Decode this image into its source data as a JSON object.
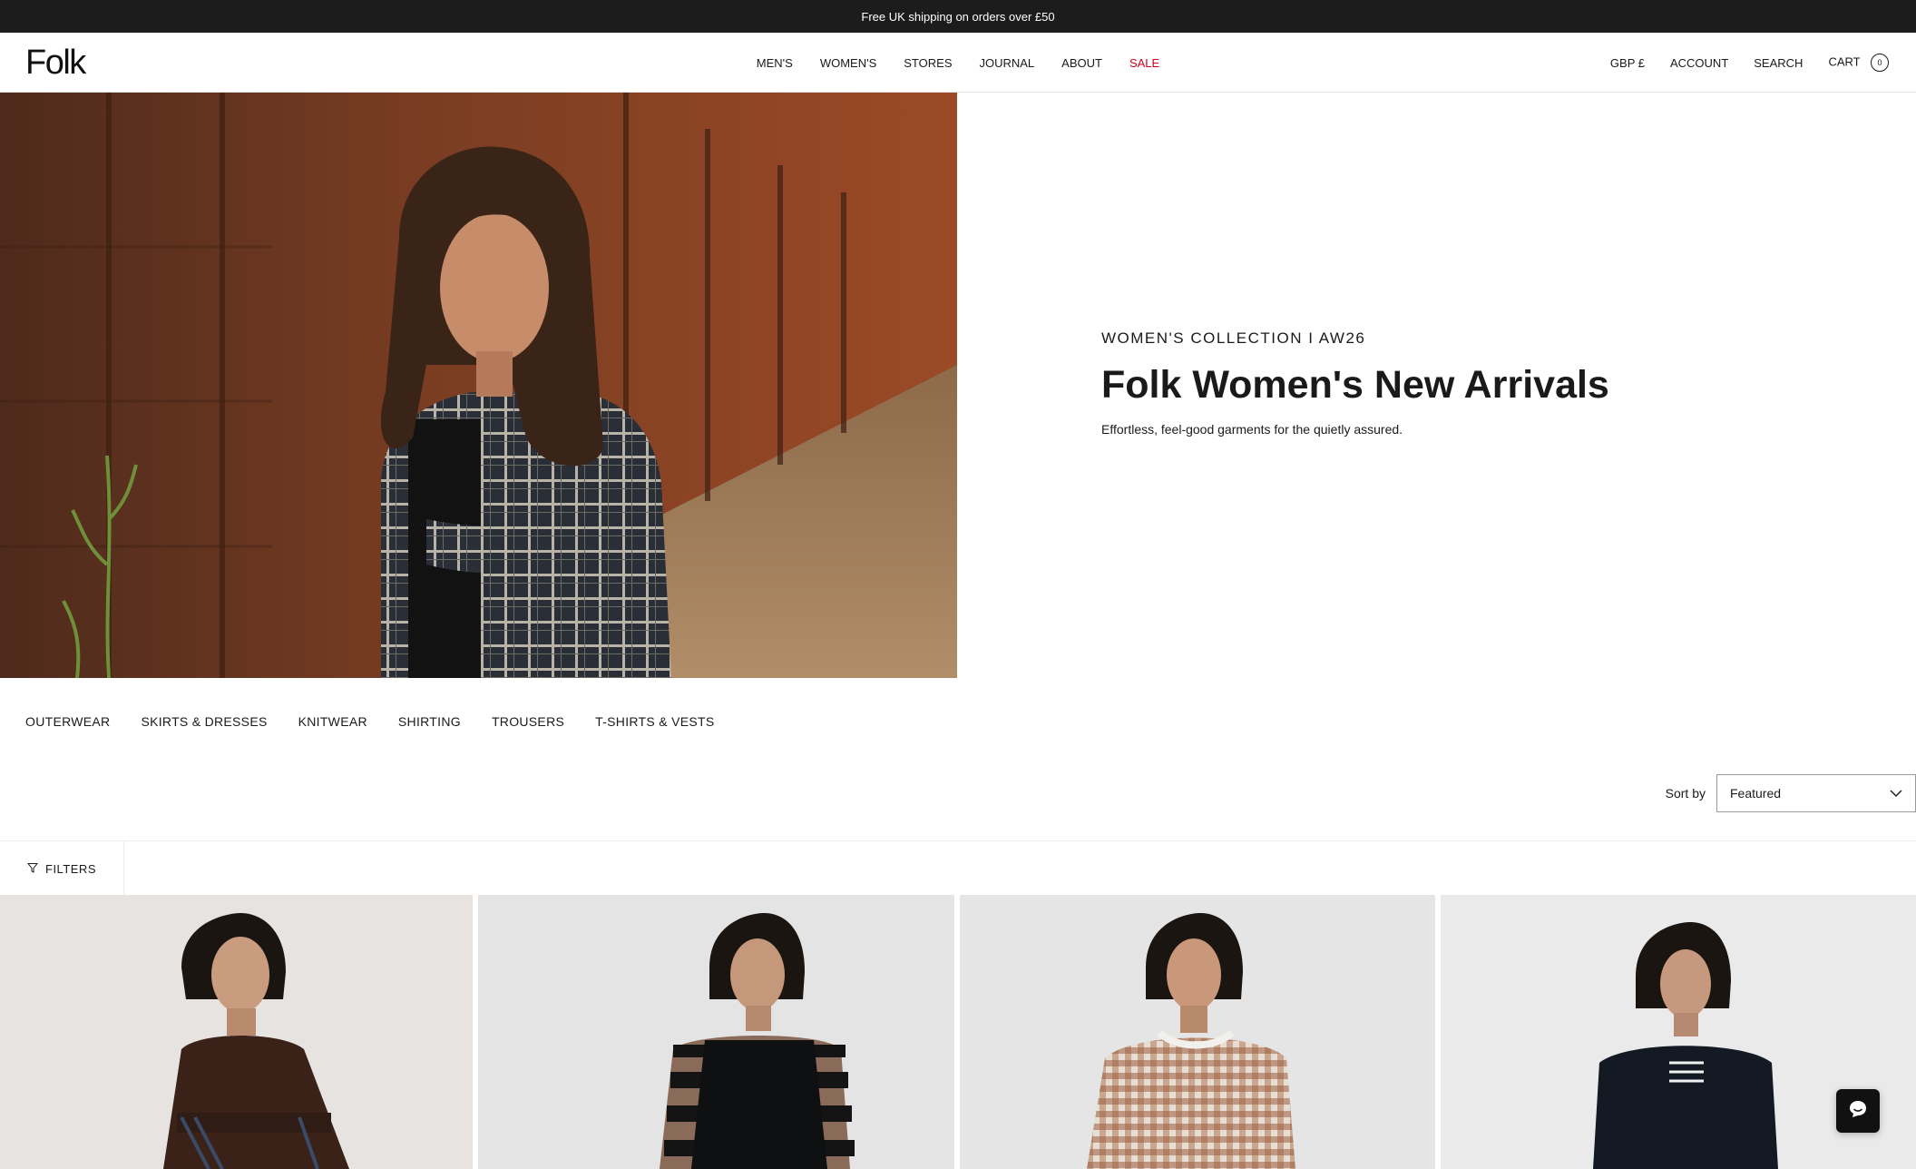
{
  "announcement": {
    "text": "Free UK shipping on orders over £50"
  },
  "header": {
    "logo": "Folk",
    "nav": [
      {
        "label": "MEN'S",
        "sale": false
      },
      {
        "label": "WOMEN'S",
        "sale": false
      },
      {
        "label": "STORES",
        "sale": false
      },
      {
        "label": "JOURNAL",
        "sale": false
      },
      {
        "label": "ABOUT",
        "sale": false
      },
      {
        "label": "SALE",
        "sale": true
      }
    ],
    "currency": "GBP £",
    "account": "ACCOUNT",
    "search": "SEARCH",
    "cart": {
      "label": "CART",
      "count": "0"
    }
  },
  "hero": {
    "eyebrow": "WOMEN'S COLLECTION I AW26",
    "title": "Folk Women's New Arrivals",
    "subtitle": "Effortless, feel-good garments for the quietly assured."
  },
  "categories": [
    "OUTERWEAR",
    "SKIRTS & DRESSES",
    "KNITWEAR",
    "SHIRTING",
    "TROUSERS",
    "T-SHIRTS & VESTS"
  ],
  "sort": {
    "label": "Sort by",
    "selected": "Featured"
  },
  "filters": {
    "label": "FILTERS"
  },
  "colors": {
    "sale": "#d0021b",
    "announcement_bg": "#1c1c1c",
    "chat_bg": "#111111"
  }
}
